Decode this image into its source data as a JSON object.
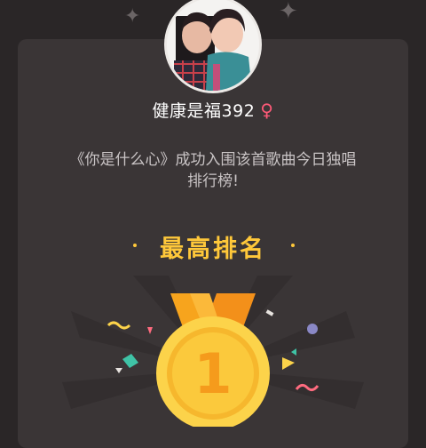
{
  "user": {
    "name": "健康是福392",
    "gender_symbol": "♀"
  },
  "message": {
    "line1": "《你是什么心》成功入围该首歌曲今日独唱",
    "line2": "排行榜!"
  },
  "rank": {
    "title": "最高排名",
    "position": "1"
  },
  "colors": {
    "background": "#2a2627",
    "card": "#3a3536",
    "accent_gold": "#ffc83a",
    "gender_pink": "#ff5a78",
    "medal_ribbon": "#f7a41d"
  },
  "icons": {
    "avatar": "user-photo",
    "gender": "female-symbol",
    "medal": "gold-medal-icon",
    "sparkle": "sparkle-icon"
  }
}
